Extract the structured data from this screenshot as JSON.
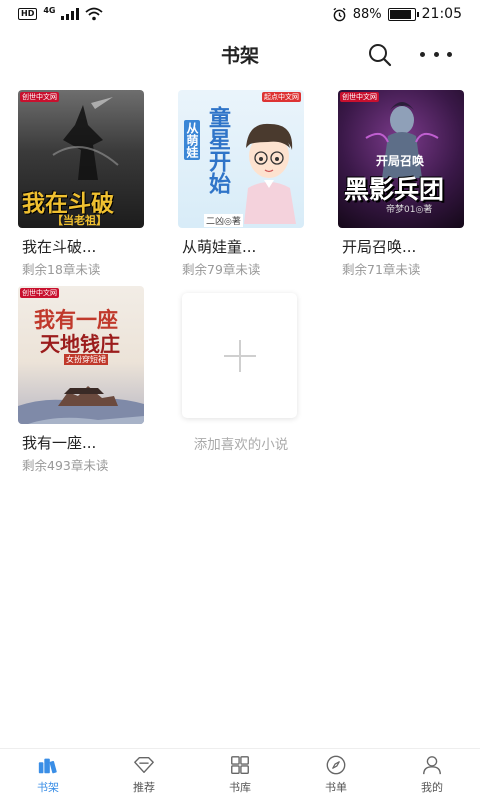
{
  "status_bar": {
    "hd": "HD",
    "network": "4G",
    "battery_percent": "88%",
    "battery_level": 0.88,
    "time": "21:05"
  },
  "header": {
    "title": "书架"
  },
  "books": [
    {
      "title": "我在斗破...",
      "subtitle": "剩余18章未读",
      "cover_text": "我在斗破",
      "cover_sub": "【当老祖】",
      "cover_logo": "创世中文网"
    },
    {
      "title": "从萌娃童...",
      "subtitle": "剩余79章未读",
      "cover_text": "童星开始",
      "cover_sub": "从萌娃",
      "cover_logo": "起点中文网",
      "cover_author": "二凶◎著"
    },
    {
      "title": "开局召唤...",
      "subtitle": "剩余71章未读",
      "cover_text": "黑影兵团",
      "cover_sub": "开局召唤",
      "cover_logo": "创世中文网",
      "cover_author": "帝梦01◎著"
    },
    {
      "title": "我有一座...",
      "subtitle": "剩余493章未读",
      "cover_text": "我有一座",
      "cover_sub": "天地钱庄",
      "cover_logo": "创世中文网",
      "cover_author": "女扮穿短裙"
    }
  ],
  "add_book": {
    "label": "添加喜欢的小说"
  },
  "bottom_nav": [
    {
      "label": "书架",
      "icon": "bookshelf-icon",
      "active": true
    },
    {
      "label": "推荐",
      "icon": "diamond-icon",
      "active": false
    },
    {
      "label": "书库",
      "icon": "grid-icon",
      "active": false
    },
    {
      "label": "书单",
      "icon": "compass-icon",
      "active": false
    },
    {
      "label": "我的",
      "icon": "user-icon",
      "active": false
    }
  ],
  "colors": {
    "accent": "#3a8ee6",
    "text_primary": "#222222",
    "text_secondary": "#999999"
  }
}
